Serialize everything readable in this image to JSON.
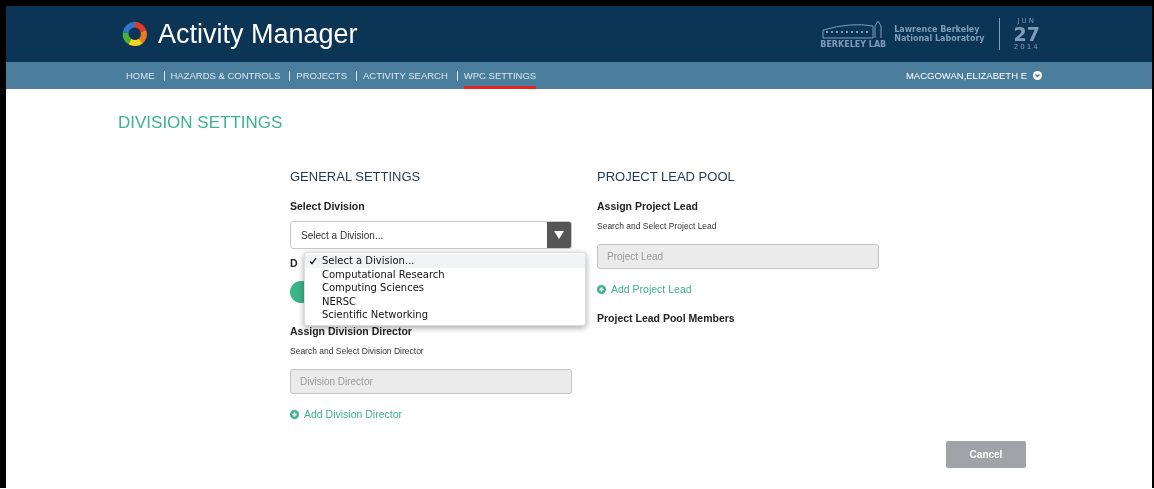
{
  "header": {
    "app_title": "Activity Manager",
    "lab_name": "BERKELEY LAB",
    "lab_full_name": [
      "Lawrence Berkeley",
      "National Laboratory"
    ],
    "date": {
      "month": "JUN",
      "day": "27",
      "year": "2014"
    }
  },
  "nav": {
    "items": [
      {
        "label": "HOME",
        "selected": false
      },
      {
        "label": "HAZARDS & CONTROLS",
        "selected": false
      },
      {
        "label": "PROJECTS",
        "selected": false
      },
      {
        "label": "ACTIVITY SEARCH",
        "selected": false
      },
      {
        "label": "WPC SETTINGS",
        "selected": true
      }
    ],
    "user": "MACGOWAN,ELIZABETH E"
  },
  "page_title": "DIVISION SETTINGS",
  "general_settings": {
    "heading": "GENERAL SETTINGS",
    "select_label": "Select Division",
    "select_value": "Select a Division...",
    "covered_label": "D",
    "covered_toggle": {
      "on": true
    },
    "dropdown_options": [
      {
        "label": "Select a Division...",
        "selected": true
      },
      {
        "label": "Computational Research",
        "selected": false
      },
      {
        "label": "Computing Sciences",
        "selected": false
      },
      {
        "label": "NERSC",
        "selected": false
      },
      {
        "label": "Scientific Networking",
        "selected": false
      }
    ],
    "director_heading": "Assign Division Director",
    "director_hint": "Search and Select Division Director",
    "director_placeholder": "Division Director",
    "add_director": "Add Division Director"
  },
  "project_lead_pool": {
    "heading": "PROJECT LEAD POOL",
    "assign_heading": "Assign Project Lead",
    "hint": "Search and Select Project Lead",
    "placeholder": "Project Lead",
    "add_link": "Add Project Lead",
    "members_heading": "Project Lead Pool Members"
  },
  "buttons": {
    "cancel": "Cancel"
  }
}
